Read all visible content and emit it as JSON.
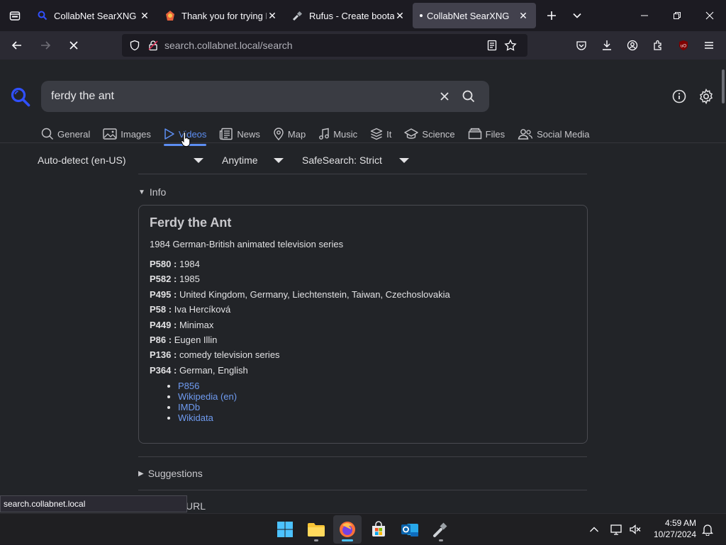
{
  "browser": {
    "tabs": [
      {
        "title": "CollabNet SearXNG",
        "favicon": "searxng-icon",
        "active": false
      },
      {
        "title": "Thank you for trying D",
        "favicon": "app-icon",
        "active": false
      },
      {
        "title": "Rufus - Create bootabl",
        "favicon": "usb-icon",
        "active": false
      },
      {
        "title": "CollabNet SearXNG",
        "favicon": "searxng-icon",
        "active": true
      }
    ],
    "url_host": "search.collabnet.local",
    "url_path": "/search",
    "status_url": "search.collabnet.local"
  },
  "search": {
    "query": "ferdy the ant",
    "categories": [
      {
        "label": "General",
        "icon": "search-icon"
      },
      {
        "label": "Images",
        "icon": "image-icon"
      },
      {
        "label": "Videos",
        "icon": "play-icon",
        "active": true
      },
      {
        "label": "News",
        "icon": "newspaper-icon"
      },
      {
        "label": "Map",
        "icon": "map-pin-icon"
      },
      {
        "label": "Music",
        "icon": "music-icon"
      },
      {
        "label": "It",
        "icon": "layers-icon"
      },
      {
        "label": "Science",
        "icon": "school-icon"
      },
      {
        "label": "Files",
        "icon": "files-icon"
      },
      {
        "label": "Social Media",
        "icon": "people-icon"
      }
    ],
    "filters": {
      "language": "Auto-detect (en-US)",
      "time": "Anytime",
      "safesearch": "SafeSearch: Strict"
    }
  },
  "infobox": {
    "summary": "Info",
    "title": "Ferdy the Ant",
    "description": "1984 German-British animated television series",
    "attributes": [
      {
        "key": "P580 :",
        "value": "1984"
      },
      {
        "key": "P582 :",
        "value": "1985"
      },
      {
        "key": "P495 :",
        "value": "United Kingdom, Germany, Liechtenstein, Taiwan, Czechoslovakia"
      },
      {
        "key": "P58 :",
        "value": "Iva Hercíková"
      },
      {
        "key": "P449 :",
        "value": "Minimax"
      },
      {
        "key": "P86 :",
        "value": "Eugen Illin"
      },
      {
        "key": "P136 :",
        "value": "comedy television series"
      },
      {
        "key": "P364 :",
        "value": "German, English"
      }
    ],
    "links": [
      "P856",
      "Wikipedia (en)",
      "IMDb",
      "Wikidata"
    ]
  },
  "sections": {
    "suggestions": "Suggestions",
    "url_partial": "URL"
  },
  "taskbar": {
    "time": "4:59 AM",
    "date": "10/27/2024"
  },
  "colors": {
    "accent": "#5d8ef2",
    "link": "#6f9bf0",
    "page_bg": "#222428",
    "chrome_bg": "#1c1b22"
  }
}
